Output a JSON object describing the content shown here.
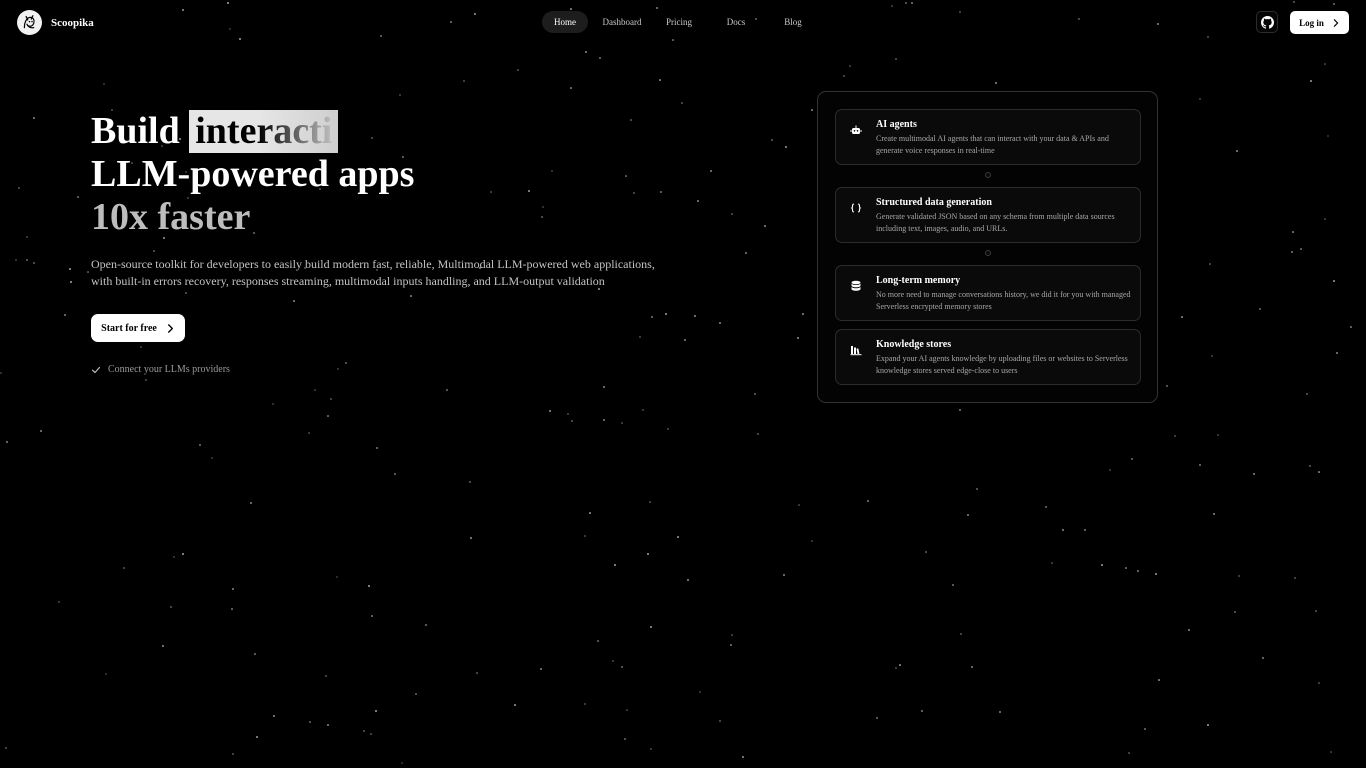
{
  "brand": {
    "name": "Scoopika"
  },
  "nav": [
    {
      "label": "Home",
      "active": true
    },
    {
      "label": "Dashboard"
    },
    {
      "label": "Pricing"
    },
    {
      "label": "Docs"
    },
    {
      "label": "Blog"
    }
  ],
  "header": {
    "login_label": "Log in",
    "github_icon": "github-icon"
  },
  "hero": {
    "line1_prefix": "Build",
    "line1_typed": "interacti",
    "line2": "LLM-powered apps",
    "line3": "10x faster",
    "description": "Open-source toolkit for developers to easily build modern fast, reliable, Multimodal LLM-powered web applications, with built-in errors recovery, responses streaming, multimodal inputs handling, and LLM-output validation",
    "cta_label": "Start for free",
    "connect_text": "Connect your LLMs providers"
  },
  "features": [
    {
      "icon": "robot-icon",
      "title": "AI agents",
      "desc": "Create multimodal AI agents that can interact with your data & APIs and generate voice responses in real-time"
    },
    {
      "icon": "braces-icon",
      "title": "Structured data generation",
      "desc": "Generate validated JSON based on any schema from multiple data sources including text, images, audio, and URLs."
    },
    {
      "icon": "database-icon",
      "title": "Long-term memory",
      "desc": "No more need to manage conversations history, we did it for you with managed Serverless encrypted memory stores"
    },
    {
      "icon": "library-icon",
      "title": "Knowledge stores",
      "desc": "Expand your AI agents knowledge by uploading files or websites to Serverless knowledge stores served edge-close to users"
    }
  ],
  "colors": {
    "background": "#000000",
    "text": "#ffffff",
    "muted": "#a8a8a8",
    "border": "#2c2c2c"
  }
}
